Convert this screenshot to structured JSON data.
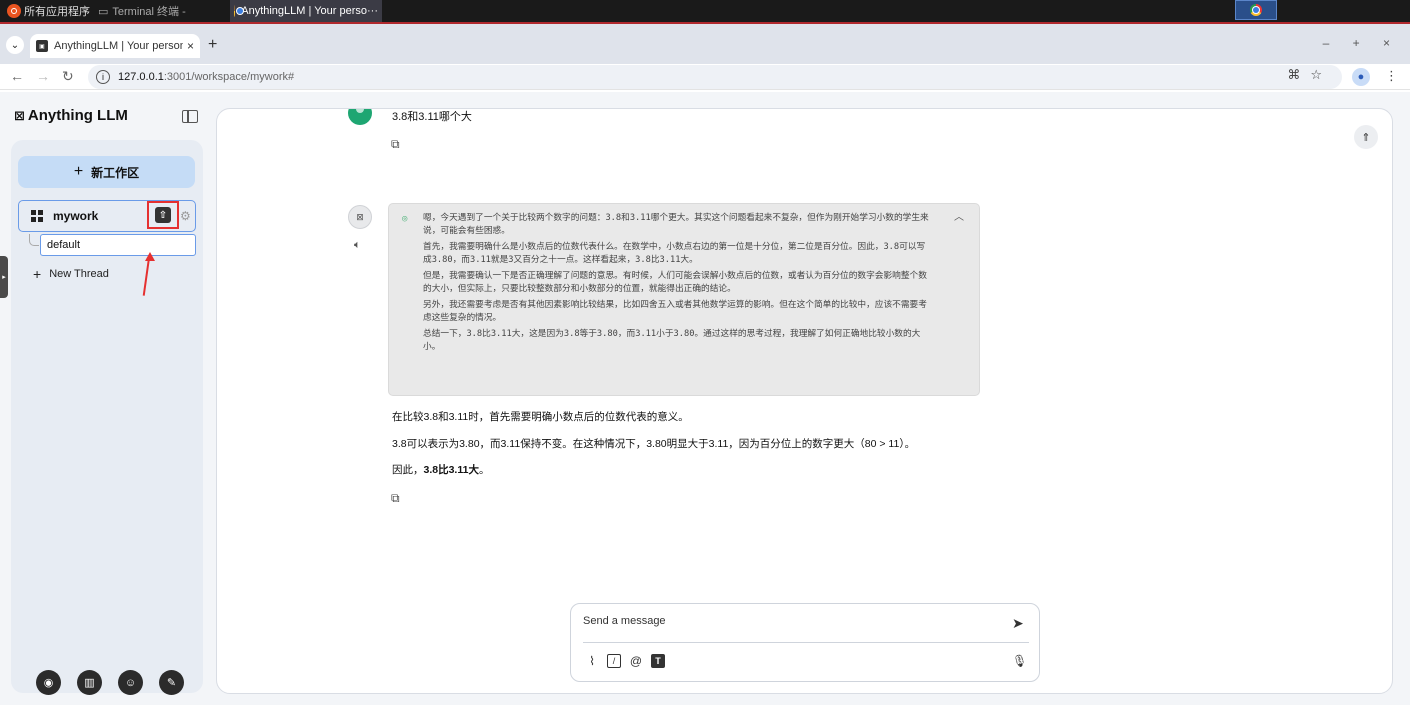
{
  "taskbar": {
    "apps_label": "所有应用程序",
    "terminal_label": "Terminal 终端 -",
    "browser_label": "AnythingLLM | Your perso···"
  },
  "browser": {
    "tab_title": "AnythingLLM | Your personal",
    "url_host": "127.0.0.1",
    "url_path": ":3001/workspace/mywork#"
  },
  "sidebar": {
    "logo": "Anything LLM",
    "new_workspace": "新工作区",
    "workspace_name": "mywork",
    "thread_name": "default",
    "new_thread": "New Thread"
  },
  "chat": {
    "user_message": "3.8和3.11哪个大",
    "thinking": [
      "嗯，今天遇到了一个关于比较两个数字的问题：3.8和3.11哪个更大。其实这个问题看起来不复杂，但作为刚开始学习小数的学生来说，可能会有些困惑。",
      "首先，我需要明确什么是小数点后的位数代表什么。在数学中，小数点右边的第一位是十分位，第二位是百分位。因此，3.8可以写成3.80，而3.11就是3又百分之十一点。这样看起来，3.8比3.11大。",
      "但是，我需要确认一下是否正确理解了问题的意思。有时候，人们可能会误解小数点后的位数，或者认为百分位的数字会影响整个数的大小，但实际上，只要比较整数部分和小数部分的位置，就能得出正确的结论。",
      "另外，我还需要考虑是否有其他因素影响比较结果，比如四舍五入或者其他数学运算的影响。但在这个简单的比较中，应该不需要考虑这些复杂的情况。",
      "总结一下，3.8比3.11大，这是因为3.8等于3.80，而3.11小于3.80。通过这样的思考过程，我理解了如何正确地比较小数的大小。"
    ],
    "answer_1": "在比较3.8和3.11时，首先需要明确小数点后的位数代表的意义。",
    "answer_2": "3.8可以表示为3.80，而3.11保持不变。在这种情况下，3.80明显大于3.11，因为百分位上的数字更大（80 > 11）。",
    "answer_3_prefix": "因此，",
    "answer_3_bold": "3.8比3.11大",
    "answer_3_suffix": "。"
  },
  "composer": {
    "placeholder": "Send a message"
  }
}
